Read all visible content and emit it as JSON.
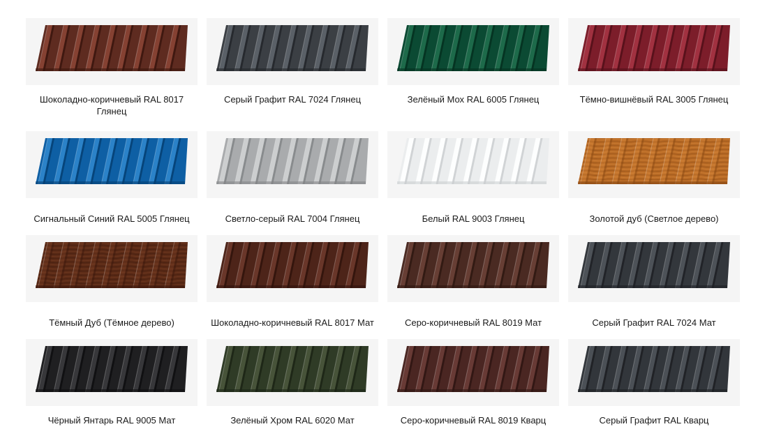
{
  "items": [
    {
      "label": "Шоколадно-коричневый RAL 8017 Глянец",
      "color": "#5e2b20",
      "light": "#8a4434",
      "dark": "#3a150e",
      "texture": "solid"
    },
    {
      "label": "Серый Графит RAL 7024 Глянец",
      "color": "#3b3f44",
      "light": "#5e646b",
      "dark": "#23262a",
      "texture": "solid"
    },
    {
      "label": "Зелёный Мох RAL 6005 Глянец",
      "color": "#0b4a33",
      "light": "#1f6e4d",
      "dark": "#053020",
      "texture": "solid"
    },
    {
      "label": "Тёмно-вишнёвый RAL 3005 Глянец",
      "color": "#7c1d2a",
      "light": "#a53443",
      "dark": "#520f19",
      "texture": "solid"
    },
    {
      "label": "Сигнальный Синий RAL 5005 Глянец",
      "color": "#0e5fa4",
      "light": "#2f86cc",
      "dark": "#053f73",
      "texture": "solid"
    },
    {
      "label": "Светло-серый RAL 7004 Глянец",
      "color": "#a9abad",
      "light": "#cfd1d3",
      "dark": "#838587",
      "texture": "solid"
    },
    {
      "label": "Белый RAL 9003 Глянец",
      "color": "#ebedee",
      "light": "#ffffff",
      "dark": "#cbced0",
      "texture": "solid"
    },
    {
      "label": "Золотой дуб (Светлое дерево)",
      "color": "#b86a25",
      "light": "#d98a3d",
      "dark": "#8a4a14",
      "texture": "wood"
    },
    {
      "label": "Тёмный Дуб (Тёмное дерево)",
      "color": "#5a2a16",
      "light": "#7a3f24",
      "dark": "#3c180b",
      "texture": "wood"
    },
    {
      "label": "Шоколадно-коричневый RAL 8017 Мат",
      "color": "#4d2419",
      "light": "#6d382b",
      "dark": "#30130c",
      "texture": "solid"
    },
    {
      "label": "Серо-коричневый RAL 8019 Мат",
      "color": "#4a2a22",
      "light": "#6a4036",
      "dark": "#2e1711",
      "texture": "solid"
    },
    {
      "label": "Серый Графит RAL 7024 Мат",
      "color": "#33373c",
      "light": "#50555b",
      "dark": "#1e2024",
      "texture": "solid"
    },
    {
      "label": "Чёрный Янтарь RAL 9005 Мат",
      "color": "#1f1f21",
      "light": "#3a3a3d",
      "dark": "#0e0e0f",
      "texture": "solid"
    },
    {
      "label": "Зелёный Хром RAL 6020 Мат",
      "color": "#2f3b26",
      "light": "#4a573c",
      "dark": "#1b2415",
      "texture": "solid"
    },
    {
      "label": "Серо-коричневый RAL 8019 Кварц",
      "color": "#4a2622",
      "light": "#6c3d37",
      "dark": "#2e1512",
      "texture": "solid"
    },
    {
      "label": "Серый Графит RAL Кварц",
      "color": "#32363b",
      "light": "#4e535a",
      "dark": "#1d1f23",
      "texture": "solid"
    }
  ]
}
